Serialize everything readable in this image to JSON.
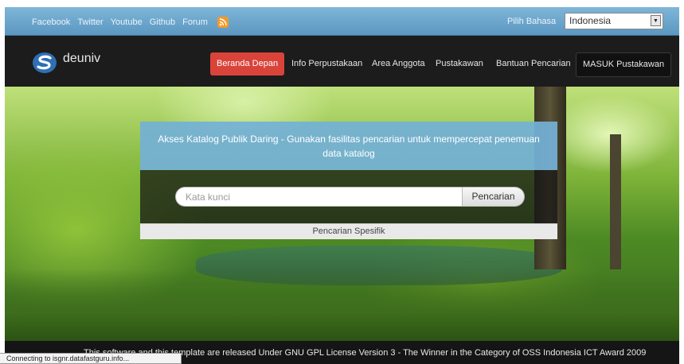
{
  "topbar": {
    "links": [
      "Facebook",
      "Twitter",
      "Youtube",
      "Github",
      "Forum"
    ],
    "rss_icon": "rss-icon",
    "language_label": "Pilih Bahasa",
    "language_value": "Indonesia"
  },
  "navbar": {
    "brand": "deuniv",
    "items": [
      "Beranda Depan",
      "Info Perpustakaan",
      "Area Anggota",
      "Pustakawan",
      "Bantuan Pencarian",
      "MASUK Pustakawan"
    ],
    "active_item": "Beranda Depan"
  },
  "search": {
    "heading": "Akses Katalog Publik Daring - Gunakan fasilitas pencarian untuk mempercepat penemuan data katalog",
    "placeholder": "Kata kunci",
    "button_label": "Pencarian",
    "specific_link": "Pencarian Spesifik"
  },
  "footer": {
    "text": "This software and this template are released Under GNU GPL License Version 3 - The Winner in the Category of OSS Indonesia ICT Award 2009"
  },
  "browser_status": "Connecting to isgnr.datafastguru.info...",
  "colors": {
    "topbar": "#6aa6cf",
    "active_nav": "#d9433a",
    "search_header": "#74b0d6",
    "rss": "#f39a2b"
  }
}
